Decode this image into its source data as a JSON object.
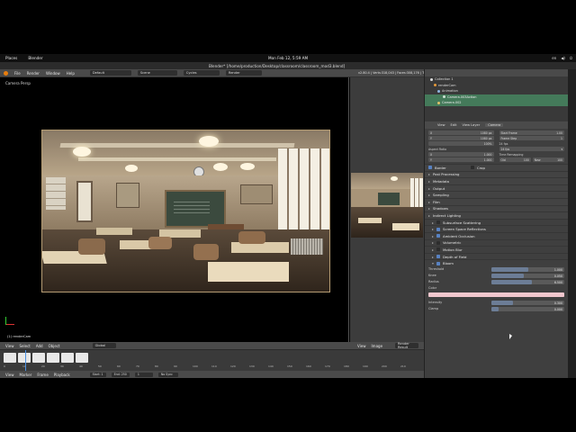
{
  "os": {
    "places": "Places",
    "app": "Blender",
    "clock": "Mon Feb 12,  5:59 AM",
    "tray": [
      "en",
      "◀)",
      "⏻"
    ]
  },
  "window": {
    "title": "Blender* [/home/production/Desktop/classroom/classroom_mod3.blend]"
  },
  "info": {
    "menus": [
      "File",
      "Render",
      "Window",
      "Help"
    ],
    "layout": "Default",
    "scene_label": "Scene",
    "engine": "Cycles",
    "render_to": "Render",
    "version_stats": "v2.80.4 | Verts:318,043 | Faces:308,176 | Tris:605,814 | Objects:1/620 | Lamps:0/8 | Mem:869.78M | CameraDebl"
  },
  "viewport": {
    "label": "Camera Persp",
    "object_label": "(1) renderCam"
  },
  "outliner": {
    "rows": [
      {
        "label": "Collection 1",
        "selected": false
      },
      {
        "label": "renderCam",
        "selected": false
      },
      {
        "label": "Animation",
        "selected": false
      },
      {
        "label": "Camera.003Action",
        "selected": true
      },
      {
        "label": "Camera.002",
        "selected": true
      }
    ]
  },
  "properties": {
    "tabs": [
      "View",
      "Edit",
      "View Layer",
      "Camera"
    ],
    "resolution": {
      "res_x": "1080 px",
      "res_y": "1080 px",
      "percent": "100%",
      "start_frame_label": "Start Frame",
      "start_frame": "1.00",
      "frame_step_label": "Frame Step",
      "aspect_label": "Aspect Ratio",
      "aspect_x": "1.000",
      "aspect_y": "1.000",
      "frame_rate": "24 fps",
      "time_remap": "Time Remapping",
      "old": "Old",
      "old_val": "100",
      "new": "New",
      "new_val": "100"
    },
    "border": {
      "label": "Border",
      "crop": "Crop"
    },
    "sections": [
      "Post Processing",
      "Metadata",
      "Output",
      "Sampling",
      "Film",
      "Shadows",
      "Indirect Lighting",
      "Subsurface Scattering",
      "Screen Space Reflections",
      "Ambient Occlusion",
      "Volumetric",
      "Motion Blur",
      "Depth of Field",
      "Bloom"
    ],
    "bloom": {
      "threshold_label": "Threshold",
      "threshold": "1.000",
      "knee_label": "Knee",
      "knee": "0.050",
      "radius_label": "Radius",
      "radius": "6.500",
      "color_label": "Color",
      "intensity_label": "Intensity",
      "intensity": "0.300",
      "clamp_label": "Clamp",
      "clamp": "0.000"
    },
    "progress": {
      "threshold": 0.5,
      "knee": 0.45,
      "radius": 0.55,
      "intensity": 0.3,
      "clamp": 0.1
    }
  },
  "image_editor": {
    "menus": [
      "View",
      "Image"
    ],
    "slot": "Render Result"
  },
  "timeline": {
    "menus": [
      "View",
      "Select",
      "Add",
      "Object"
    ],
    "mode": "Global",
    "frame_labels": [
      "0",
      "10",
      "20",
      "30",
      "40",
      "50",
      "60",
      "70",
      "80",
      "90",
      "100",
      "110",
      "120",
      "130",
      "140",
      "150",
      "160",
      "170",
      "180",
      "190",
      "200",
      "210"
    ],
    "bottom_menus": [
      "View",
      "Marker",
      "Frame",
      "Playback"
    ],
    "start_label": "Start:",
    "start": "1",
    "end_label": "End:",
    "end": "250",
    "current": "1",
    "sync": "No Sync"
  }
}
